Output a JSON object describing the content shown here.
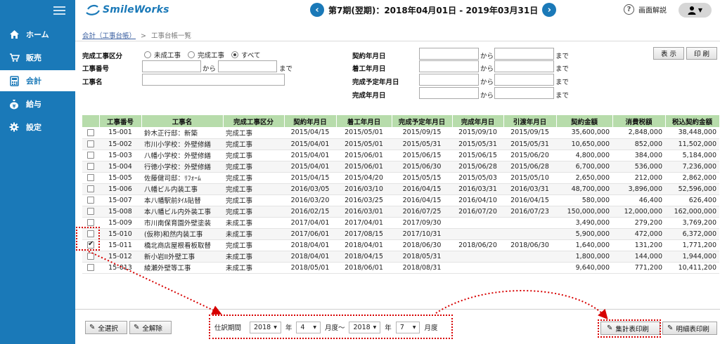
{
  "sidebar": {
    "items": [
      {
        "label": "ホーム",
        "icon": "home-icon"
      },
      {
        "label": "販売",
        "icon": "cart-icon"
      },
      {
        "label": "会計",
        "icon": "calculator-icon",
        "active": true
      },
      {
        "label": "給与",
        "icon": "yen-bag-icon"
      },
      {
        "label": "設定",
        "icon": "gear-icon"
      }
    ]
  },
  "header": {
    "logo_text": "SmileWorks",
    "period_text": "第7期(翌期)：2018年04月01日 - 2019年03月31日",
    "prev_glyph": "‹",
    "next_glyph": "›",
    "help_label": "画面解説"
  },
  "breadcrumb": {
    "link": "会計（工事台帳）",
    "separator": ">",
    "current": "工事台帳一覧"
  },
  "filters": {
    "status_label": "完成工事区分",
    "status_options": [
      "未成工事",
      "完成工事",
      "すべて"
    ],
    "status_selected": "すべて",
    "number_label": "工事番号",
    "name_label": "工事名",
    "from_word": "から",
    "to_word": "まで",
    "contract_date_label": "契約年月日",
    "start_date_label": "着工年月日",
    "planned_completion_label": "完成予定年月日",
    "completion_date_label": "完成年月日",
    "show_button": "表 示",
    "print_button": "印 刷"
  },
  "table": {
    "headers": [
      "",
      "工事番号",
      "工事名",
      "完成工事区分",
      "契約年月日",
      "着工年月日",
      "完成予定年月日",
      "完成年月日",
      "引渡年月日",
      "契約金額",
      "消費税額",
      "税込契約金額"
    ],
    "rows": [
      {
        "checked": false,
        "no": "15-001",
        "name": "鈴木正行邸：新築",
        "status": "完成工事",
        "contract": "2015/04/15",
        "start": "2015/05/01",
        "planned": "2015/09/15",
        "completed": "2015/09/10",
        "delivered": "2015/09/15",
        "amount": "35,600,000",
        "tax": "2,848,000",
        "total": "38,448,000"
      },
      {
        "checked": false,
        "no": "15-002",
        "name": "市川小学校：外壁修繕",
        "status": "完成工事",
        "contract": "2015/04/01",
        "start": "2015/05/01",
        "planned": "2015/05/31",
        "completed": "2015/05/31",
        "delivered": "2015/05/31",
        "amount": "10,650,000",
        "tax": "852,000",
        "total": "11,502,000"
      },
      {
        "checked": false,
        "no": "15-003",
        "name": "八幡小学校：外壁修繕",
        "status": "完成工事",
        "contract": "2015/04/01",
        "start": "2015/06/01",
        "planned": "2015/06/15",
        "completed": "2015/06/15",
        "delivered": "2015/06/20",
        "amount": "4,800,000",
        "tax": "384,000",
        "total": "5,184,000"
      },
      {
        "checked": false,
        "no": "15-004",
        "name": "行徳小学校：外壁修繕",
        "status": "完成工事",
        "contract": "2015/04/01",
        "start": "2015/06/01",
        "planned": "2015/06/30",
        "completed": "2015/06/28",
        "delivered": "2015/06/28",
        "amount": "6,700,000",
        "tax": "536,000",
        "total": "7,236,000"
      },
      {
        "checked": false,
        "no": "15-005",
        "name": "佐藤健司邸：ﾘﾌｫｰﾑ",
        "status": "完成工事",
        "contract": "2015/04/15",
        "start": "2015/04/20",
        "planned": "2015/05/15",
        "completed": "2015/05/03",
        "delivered": "2015/05/10",
        "amount": "2,650,000",
        "tax": "212,000",
        "total": "2,862,000"
      },
      {
        "checked": false,
        "no": "15-006",
        "name": "八幡ビル内装工事",
        "status": "完成工事",
        "contract": "2016/03/05",
        "start": "2016/03/10",
        "planned": "2016/04/15",
        "completed": "2016/03/31",
        "delivered": "2016/03/31",
        "amount": "48,700,000",
        "tax": "3,896,000",
        "total": "52,596,000"
      },
      {
        "checked": false,
        "no": "15-007",
        "name": "本八幡駅前ﾀｲﾙ貼替",
        "status": "完成工事",
        "contract": "2016/03/20",
        "start": "2016/03/25",
        "planned": "2016/04/15",
        "completed": "2016/04/10",
        "delivered": "2016/04/15",
        "amount": "580,000",
        "tax": "46,400",
        "total": "626,400"
      },
      {
        "checked": false,
        "no": "15-008",
        "name": "本八幡ビル内外装工事",
        "status": "完成工事",
        "contract": "2016/02/15",
        "start": "2016/03/01",
        "planned": "2016/07/25",
        "completed": "2016/07/20",
        "delivered": "2016/07/23",
        "amount": "150,000,000",
        "tax": "12,000,000",
        "total": "162,000,000"
      },
      {
        "checked": false,
        "no": "15-009",
        "name": "市川南保育園外壁塗装",
        "status": "未成工事",
        "contract": "2017/04/01",
        "start": "2017/04/01",
        "planned": "2017/09/30",
        "completed": "",
        "delivered": "",
        "amount": "3,490,000",
        "tax": "279,200",
        "total": "3,769,200"
      },
      {
        "checked": false,
        "no": "15-010",
        "name": "(仮称)和然内装工事",
        "status": "未成工事",
        "contract": "2017/06/01",
        "start": "2017/08/15",
        "planned": "2017/10/31",
        "completed": "",
        "delivered": "",
        "amount": "5,900,000",
        "tax": "472,000",
        "total": "6,372,000"
      },
      {
        "checked": true,
        "no": "15-011",
        "name": "橋北商店屋根看板取替",
        "status": "完成工事",
        "contract": "2018/04/01",
        "start": "2018/04/01",
        "planned": "2018/06/30",
        "completed": "2018/06/20",
        "delivered": "2018/06/30",
        "amount": "1,640,000",
        "tax": "131,200",
        "total": "1,771,200"
      },
      {
        "checked": false,
        "no": "15-012",
        "name": "新小岩II外壁工事",
        "status": "未成工事",
        "contract": "2018/04/01",
        "start": "2018/04/15",
        "planned": "2018/05/31",
        "completed": "",
        "delivered": "",
        "amount": "1,800,000",
        "tax": "144,000",
        "total": "1,944,000"
      },
      {
        "checked": false,
        "no": "15-013",
        "name": "綾瀬外壁等工事",
        "status": "未成工事",
        "contract": "2018/05/01",
        "start": "2018/06/01",
        "planned": "2018/08/31",
        "completed": "",
        "delivered": "",
        "amount": "9,640,000",
        "tax": "771,200",
        "total": "10,411,200"
      }
    ]
  },
  "bottom": {
    "select_all": "全選択",
    "deselect_all": "全解除",
    "period_label": "仕訳期間",
    "from_year": "2018",
    "year_word": "年",
    "from_month": "4",
    "month_range_word": "月度～",
    "to_year": "2018",
    "to_month": "7",
    "month_word": "月度",
    "summary_print": "集計表印刷",
    "detail_print": "明細表印刷"
  },
  "annotation_color": "#d70000"
}
